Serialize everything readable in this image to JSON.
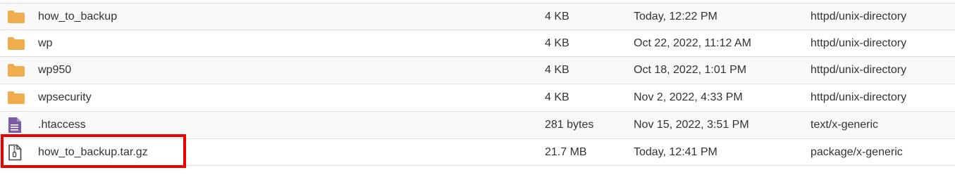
{
  "files": [
    {
      "icon": "folder-icon",
      "name": "how_to_backup",
      "size": "4 KB",
      "modified": "Today, 12:22 PM",
      "type": "httpd/unix-directory"
    },
    {
      "icon": "folder-icon",
      "name": "wp",
      "size": "4 KB",
      "modified": "Oct 22, 2022, 11:12 AM",
      "type": "httpd/unix-directory"
    },
    {
      "icon": "folder-icon",
      "name": "wp950",
      "size": "4 KB",
      "modified": "Oct 18, 2022, 1:01 PM",
      "type": "httpd/unix-directory"
    },
    {
      "icon": "folder-icon",
      "name": "wpsecurity",
      "size": "4 KB",
      "modified": "Nov 2, 2022, 4:33 PM",
      "type": "httpd/unix-directory"
    },
    {
      "icon": "text-file-icon",
      "name": ".htaccess",
      "size": "281 bytes",
      "modified": "Nov 15, 2022, 3:51 PM",
      "type": "text/x-generic"
    },
    {
      "icon": "archive-file-icon",
      "name": "how_to_backup.tar.gz",
      "size": "21.7 MB",
      "modified": "Today, 12:41 PM",
      "type": "package/x-generic"
    }
  ],
  "colors": {
    "folder": "#f0ad4e",
    "text_file": "#7b5aa6",
    "archive_outline": "#555555",
    "highlight": "#ee0000"
  }
}
